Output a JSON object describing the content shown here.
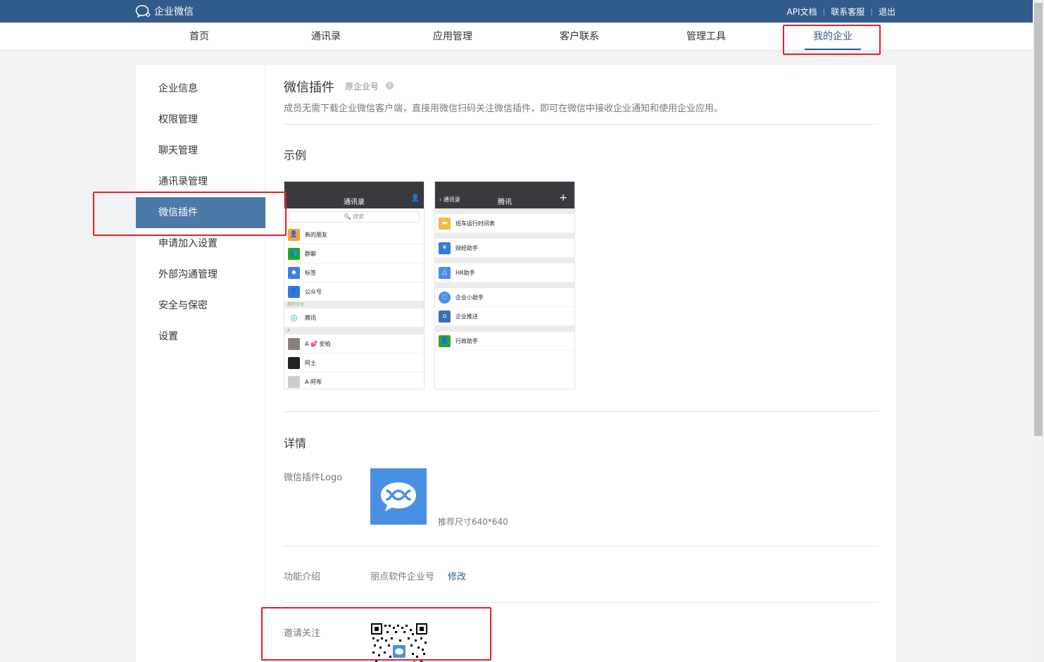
{
  "header": {
    "brand": "企业微信",
    "links": [
      "API文档",
      "联系客服",
      "退出"
    ]
  },
  "nav": {
    "items": [
      "首页",
      "通讯录",
      "应用管理",
      "客户联系",
      "管理工具",
      "我的企业"
    ],
    "active": "我的企业"
  },
  "sidebar": {
    "items": [
      "企业信息",
      "权限管理",
      "聊天管理",
      "通讯录管理",
      "微信插件",
      "申请加入设置",
      "外部沟通管理",
      "安全与保密",
      "设置"
    ],
    "active": "微信插件"
  },
  "main": {
    "title": "微信插件",
    "subtitle": "原企业号",
    "description": "成员无需下载企业微信客户端，直接用微信扫码关注微信插件，即可在微信中接收企业通知和使用企业应用。",
    "example_title": "示例",
    "details_title": "详情",
    "logo_label": "微信插件Logo",
    "logo_hint": "推荐尺寸640*640",
    "intro_label": "功能介绍",
    "intro_value": "丽点软件企业号",
    "intro_edit": "修改",
    "invite_label": "邀请关注"
  },
  "phone1": {
    "header_title": "通讯录",
    "search": "搜索",
    "rows": [
      "新的朋友",
      "群聊",
      "标签",
      "公众号"
    ],
    "group_my": "我的企业",
    "company": "腾讯",
    "group_a": "A",
    "contacts": [
      "A 💕 安柏",
      "阿土",
      "A-阿布"
    ]
  },
  "phone2": {
    "back_label": "通讯录",
    "header_title": "腾讯",
    "rows": [
      "班车运行时间表",
      "财经助手",
      "HR助手",
      "企业小助手",
      "企业推送",
      "行政助手"
    ]
  },
  "colors": {
    "topbar": "#315b8a",
    "accent": "#315b8a",
    "sidebar_active": "#4b79a8",
    "highlight": "#e5202a",
    "logo_bg": "#4a90e2"
  }
}
